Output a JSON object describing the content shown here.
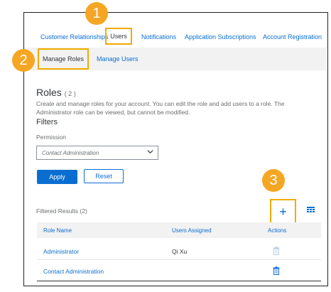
{
  "tabs": [
    {
      "label": "Customer Relationships"
    },
    {
      "label": "Users"
    },
    {
      "label": "Notifications"
    },
    {
      "label": "Application Subscriptions"
    },
    {
      "label": "Account Registration"
    }
  ],
  "subtabs": [
    {
      "label": "Manage Roles"
    },
    {
      "label": "Manage Users"
    }
  ],
  "step_badges": [
    "1",
    "2",
    "3"
  ],
  "roles": {
    "title": "Roles",
    "count": "( 2 )",
    "description": "Create and manage roles for your account. You can edit the role and add users to a role. The Administrator role can be viewed, but cannot be modified."
  },
  "filters": {
    "title": "Filters",
    "permission_label": "Permission",
    "permission_value": "Contact Administration",
    "apply_label": "Apply",
    "reset_label": "Reset"
  },
  "results": {
    "label": "Filtered Results  (2)",
    "add_symbol": "+",
    "columns": [
      "Role Name",
      "Users Assigned",
      "Actions"
    ],
    "rows": [
      {
        "role": "Administrator",
        "users": "Qi Xu"
      },
      {
        "role": "Contact Administration",
        "users": ""
      }
    ]
  },
  "colors": {
    "accent": "#0a6ed1",
    "highlight": "#f0ab00",
    "badge": "#f5a623"
  },
  "icons": {
    "add": "plus-icon",
    "table_settings": "table-settings-icon",
    "delete": "trash-icon",
    "dropdown": "chevron-down-icon"
  }
}
